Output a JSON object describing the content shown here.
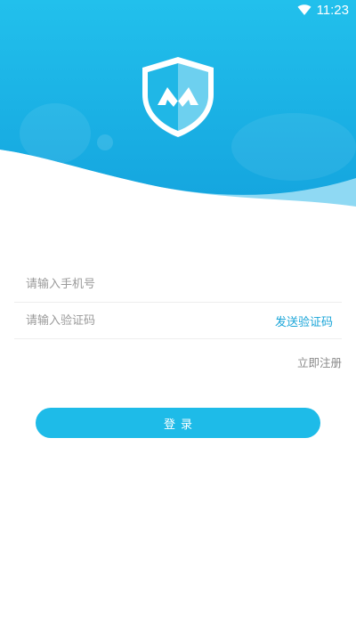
{
  "status_bar": {
    "time": "11:23"
  },
  "icons": {
    "wifi": "wifi-icon",
    "logo": "shield-logo-icon"
  },
  "colors": {
    "primary": "#1ebbe8",
    "header_gradient_top": "#22c0ec",
    "header_gradient_bottom": "#15a6df",
    "link": "#1aa5d8",
    "placeholder": "#9a9a9a"
  },
  "login_form": {
    "phone_placeholder": "请输入手机号",
    "code_placeholder": "请输入验证码",
    "send_code_label": "发送验证码",
    "register_label": "立即注册",
    "login_label": "登录"
  }
}
